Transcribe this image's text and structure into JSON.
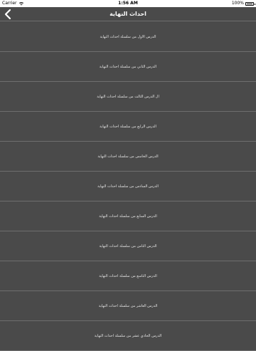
{
  "status_bar": {
    "carrier": "Carrier",
    "time": "1:56 AM",
    "battery": "100%"
  },
  "nav": {
    "title": "احداث النهاية",
    "back_icon": "chevron-left-icon"
  },
  "lessons": [
    "الدرس الاول من سلسلة احداث النهاية",
    "الدرس الثاني من سلسلة احداث النهاية",
    "ال الدرس الثالث من سلسلة احداث النهاية",
    "الدرس الرابع من سلسلة احداث النهاية",
    "الدرس الخامس من سلسلة احداث النهاية",
    "الدرس السادس من سلسلة احداث النهاية",
    "الدرس السابع من سلسلة احداث النهاية",
    "الدرس الثامن من سلسلة احداث النهاية",
    "الدرس التاسع من سلسلة احداث النهاية",
    "الدرس العاشر من سلسلة احداث النهاية",
    "الدرس الحادي عشر من سلسلة احداث النهاية"
  ]
}
